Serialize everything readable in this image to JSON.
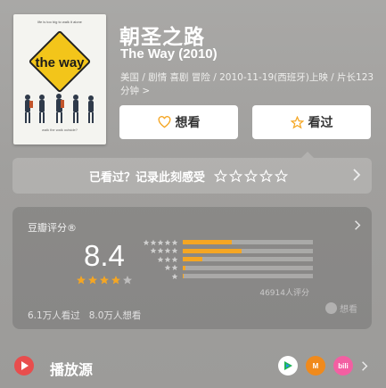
{
  "movie": {
    "title": "朝圣之路",
    "original_title": "The Way (2010)",
    "meta": "美国 / 剧情 喜剧 冒险 / 2010-11-19(西班牙)上映 / 片长123分钟 >"
  },
  "poster": {
    "tagline": "life is too big to walk it alone",
    "sign_text": "the way",
    "footer": "walk the walk outside?"
  },
  "actions": {
    "want_label": "想看",
    "seen_label": "看过"
  },
  "record": {
    "prompt": "已看过？记录此刻感受"
  },
  "rating": {
    "label": "豆瓣评分®",
    "score": "8.4",
    "stars": 4,
    "distribution": [
      {
        "stars": 5,
        "fraction": 0.38
      },
      {
        "stars": 4,
        "fraction": 0.45
      },
      {
        "stars": 3,
        "fraction": 0.15
      },
      {
        "stars": 2,
        "fraction": 0.02
      },
      {
        "stars": 1,
        "fraction": 0.01
      }
    ],
    "votes": "46914人评分",
    "think_label": "想看",
    "seen_count": "6.1万人看过",
    "want_count": "8.0万人想看"
  },
  "playback": {
    "label": "播放源",
    "platforms": [
      "tencent-video-icon",
      "mango-tv-icon",
      "bilibili-icon"
    ]
  },
  "colors": {
    "accent": "#f5a623",
    "play": "#e84d4d"
  }
}
